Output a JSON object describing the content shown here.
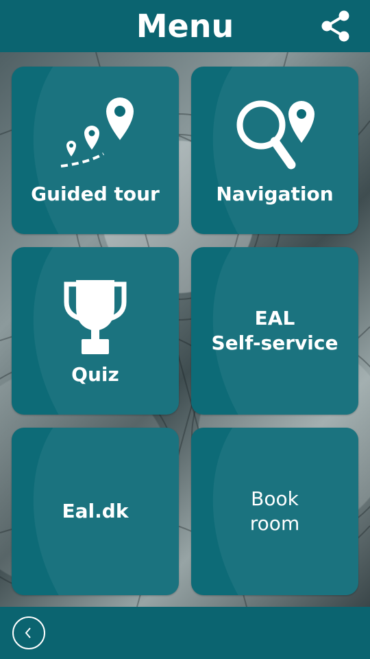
{
  "header": {
    "title": "Menu",
    "share_icon": "share-icon"
  },
  "tiles": [
    {
      "label": "Guided tour",
      "icon": "guided-tour-icon"
    },
    {
      "label": "Navigation",
      "icon": "navigation-search-icon"
    },
    {
      "label": "Quiz",
      "icon": "trophy-icon"
    },
    {
      "label_line1": "EAL",
      "label_line2": "Self-service"
    },
    {
      "label": "Eal.dk"
    },
    {
      "label_line1": "Book",
      "label_line2": "room"
    }
  ],
  "footer": {
    "back_icon": "back-icon"
  },
  "colors": {
    "primary": "#0b6470",
    "tile": "#0d6b77",
    "text": "#ffffff"
  }
}
